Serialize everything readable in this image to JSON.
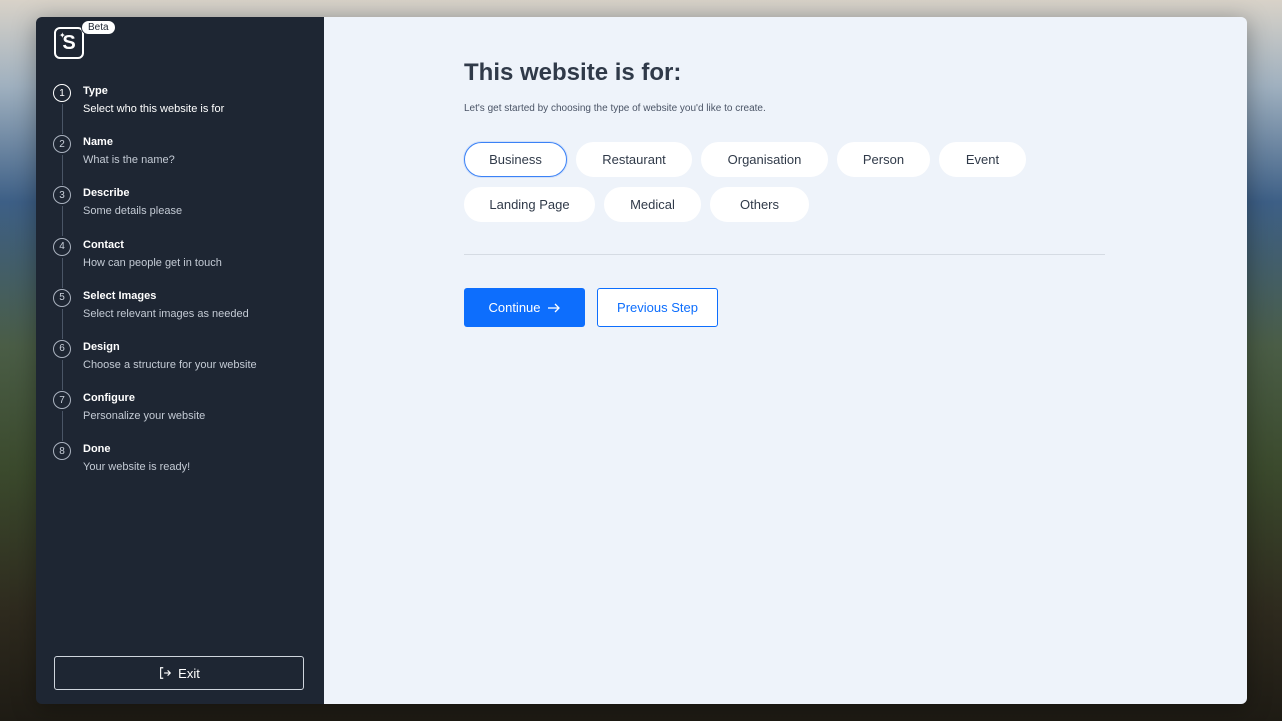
{
  "app": {
    "logo_letter": "S",
    "badge": "Beta"
  },
  "steps": [
    {
      "number": "1",
      "title": "Type",
      "subtitle": "Select who this website is for",
      "active": true
    },
    {
      "number": "2",
      "title": "Name",
      "subtitle": "What is the name?"
    },
    {
      "number": "3",
      "title": "Describe",
      "subtitle": "Some details please"
    },
    {
      "number": "4",
      "title": "Contact",
      "subtitle": "How can people get in touch"
    },
    {
      "number": "5",
      "title": "Select Images",
      "subtitle": "Select relevant images as needed"
    },
    {
      "number": "6",
      "title": "Design",
      "subtitle": "Choose a structure for your website"
    },
    {
      "number": "7",
      "title": "Configure",
      "subtitle": "Personalize your website"
    },
    {
      "number": "8",
      "title": "Done",
      "subtitle": "Your website is ready!"
    }
  ],
  "sidebar": {
    "exit_label": "Exit",
    "exit_icon": "exit-icon"
  },
  "main": {
    "title": "This website is for:",
    "subtitle": "Let's get started by choosing the type of website you'd like to create.",
    "types": [
      {
        "label": "Business",
        "selected": true
      },
      {
        "label": "Restaurant"
      },
      {
        "label": "Organisation"
      },
      {
        "label": "Person"
      },
      {
        "label": "Event"
      },
      {
        "label": "Landing Page"
      },
      {
        "label": "Medical"
      },
      {
        "label": "Others"
      }
    ],
    "continue_label": "Continue",
    "continue_icon": "arrow-right-icon",
    "previous_label": "Previous Step"
  },
  "colors": {
    "sidebar_bg": "#1e2633",
    "main_bg": "#eef3fa",
    "accent": "#0d6efd"
  }
}
